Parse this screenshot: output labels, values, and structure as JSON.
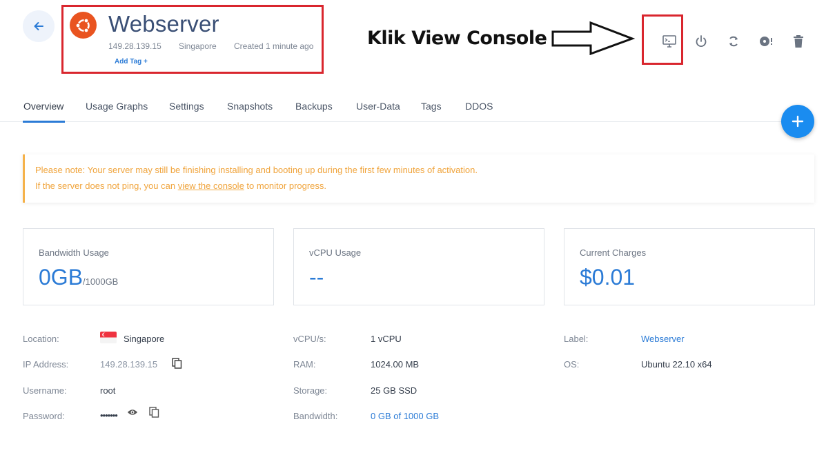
{
  "header": {
    "title": "Webserver",
    "ip": "149.28.139.15",
    "region": "Singapore",
    "created": "Created 1 minute ago",
    "add_tag": "Add Tag +"
  },
  "annotation": {
    "text": "Klik View Console"
  },
  "toolbar": {
    "icons": [
      "console-icon",
      "power-icon",
      "restart-icon",
      "iso-disc-icon",
      "trash-icon"
    ]
  },
  "tabs": [
    "Overview",
    "Usage Graphs",
    "Settings",
    "Snapshots",
    "Backups",
    "User-Data",
    "Tags",
    "DDOS"
  ],
  "notice": {
    "line1": "Please note: Your server may still be finishing installing and booting up during the first few minutes of activation.",
    "line2_prefix": "If the server does not ping, you can ",
    "line2_link": "view the console",
    "line2_suffix": " to monitor progress."
  },
  "cards": {
    "bandwidth": {
      "label": "Bandwidth Usage",
      "value": "0GB",
      "unit": "/1000GB"
    },
    "vcpu": {
      "label": "vCPU Usage",
      "value": "--"
    },
    "charges": {
      "label": "Current Charges",
      "value": "$0.01"
    }
  },
  "info": {
    "location": {
      "label": "Location:",
      "value": "Singapore"
    },
    "ip": {
      "label": "IP Address:",
      "value": "149.28.139.15"
    },
    "username": {
      "label": "Username:",
      "value": "root"
    },
    "password": {
      "label": "Password:",
      "value": "•••••••"
    },
    "vcpus": {
      "label": "vCPU/s:",
      "value": "1 vCPU"
    },
    "ram": {
      "label": "RAM:",
      "value": "1024.00 MB"
    },
    "storage": {
      "label": "Storage:",
      "value": "25 GB SSD"
    },
    "bandwidth": {
      "label": "Bandwidth:",
      "value": "0 GB of 1000 GB"
    },
    "label": {
      "label": "Label:",
      "value": "Webserver"
    },
    "os": {
      "label": "OS:",
      "value": "Ubuntu 22.10 x64"
    }
  },
  "colors": {
    "accent": "#2b7bd6",
    "ubuntu": "#e95420",
    "warning": "#f0a43c",
    "highlight": "#d9262e"
  }
}
